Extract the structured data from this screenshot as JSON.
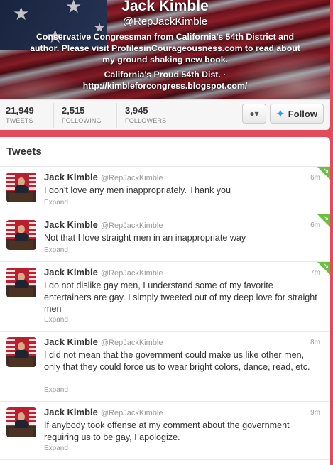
{
  "profile": {
    "name": "Jack Kimble",
    "handle": "@RepJackKimble",
    "bio": "Conservative Congressman from California's 54th District and author. Please visit ProfilesinCourageousness.com to read about my ground shaking new book.",
    "location_line": "California's Proud 54th Dist. ·",
    "url": "http://kimbleforcongress.blogspot.com/"
  },
  "stats": {
    "tweets_count": "21,949",
    "tweets_label": "TWEETS",
    "following_count": "2,515",
    "following_label": "FOLLOWING",
    "followers_count": "3,945",
    "followers_label": "FOLLOWERS"
  },
  "actions": {
    "user_menu_icon": "user-dropdown-icon",
    "follow_label": "Follow",
    "follow_icon": "twitter-bird-icon"
  },
  "stream": {
    "title": "Tweets",
    "tweets": [
      {
        "author": "Jack Kimble",
        "handle": "@RepJackKimble",
        "time": "6m",
        "text": "I don't love any men inappropriately.  Thank you",
        "expand": "Expand",
        "new": true
      },
      {
        "author": "Jack Kimble",
        "handle": "@RepJackKimble",
        "time": "6m",
        "text": "Not that I love straight men in an inappropriate way",
        "expand": "Expand",
        "new": true
      },
      {
        "author": "Jack Kimble",
        "handle": "@RepJackKimble",
        "time": "7m",
        "text": "I do not dislike gay men,  I understand some of my favorite entertainers are gay.  I simply tweeted out of my deep love for straight men",
        "expand": "Expand",
        "new": true
      },
      {
        "author": "Jack Kimble",
        "handle": "@RepJackKimble",
        "time": "8m",
        "text": "I did not mean that the government could make us like other men, only that they could force us to wear bright colors, dance, read, etc.",
        "expand": "Expand",
        "new": false
      },
      {
        "author": "Jack Kimble",
        "handle": "@RepJackKimble",
        "time": "9m",
        "text": "If anybody took offense at my comment about the government requiring us to be gay, I apologize.",
        "expand": "Expand",
        "new": false
      }
    ]
  },
  "colors": {
    "page_background": "#e44b5a",
    "new_tweet_marker": "#65c23a",
    "follow_bird": "#2aa3ef"
  }
}
